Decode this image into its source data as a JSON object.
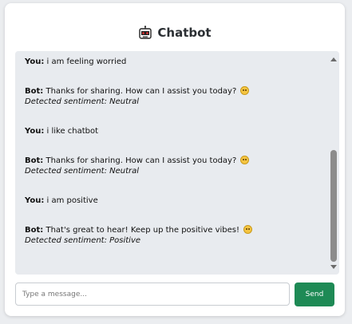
{
  "header": {
    "title": "Chatbot",
    "icon": "robot-icon"
  },
  "labels": {
    "you": "You:",
    "bot": "Bot:"
  },
  "messages": [
    {
      "sender": "you",
      "text": "i am feeling worried"
    },
    {
      "sender": "bot",
      "text": "Thanks for sharing. How can I assist you today?",
      "emoji": "slightly-smiling-face",
      "sentiment": "Detected sentiment: Neutral"
    },
    {
      "sender": "you",
      "text": "i like chatbot"
    },
    {
      "sender": "bot",
      "text": "Thanks for sharing. How can I assist you today?",
      "emoji": "slightly-smiling-face",
      "sentiment": "Detected sentiment: Neutral"
    },
    {
      "sender": "you",
      "text": "i am positive"
    },
    {
      "sender": "bot",
      "text": "That's great to hear! Keep up the positive vibes!",
      "emoji": "smiling-face",
      "sentiment": "Detected sentiment: Positive"
    }
  ],
  "input": {
    "placeholder": "Type a message...",
    "value": ""
  },
  "send_button": {
    "label": "Send"
  },
  "colors": {
    "accent": "#1e8a55",
    "chat_bg": "#e8ebef"
  }
}
